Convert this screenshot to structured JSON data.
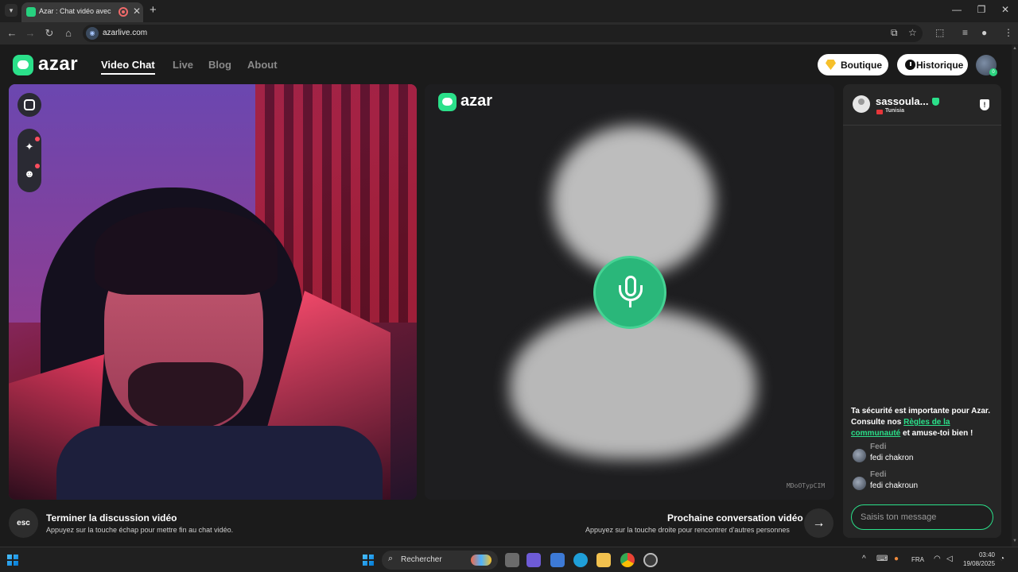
{
  "browser": {
    "tab_title": "Azar : Chat vidéo avec de n",
    "url": "azarlive.com",
    "new_tab_icon": "+",
    "close_icon": "✕"
  },
  "header": {
    "logo_text": "azar",
    "nav": [
      {
        "label": "Video Chat",
        "active": true
      },
      {
        "label": "Live",
        "active": false
      },
      {
        "label": "Blog",
        "active": false
      },
      {
        "label": "About",
        "active": false
      }
    ],
    "shop_label": "Boutique",
    "history_label": "Historique",
    "avatar_badge": "0"
  },
  "partner_video": {
    "logo_text": "azar",
    "video_id": "MDoOTypCIM"
  },
  "controls": {
    "esc_label": "esc",
    "end_title": "Terminer la discussion vidéo",
    "end_desc": "Appuyez sur la touche échap pour mettre fin au chat vidéo.",
    "next_title": "Prochaine conversation vidéo",
    "next_desc": "Appuyez sur la touche droite pour rencontrer d'autres personnes",
    "next_icon": "→"
  },
  "chat": {
    "peer_name": "sassoula...",
    "peer_country": "Tunisia",
    "report_icon": "!",
    "safety_part1": "Ta sécurité est importante pour Azar. Consulte nos ",
    "safety_link": "Règles de la communauté",
    "safety_part2": " et amuse-toi bien !",
    "messages": [
      {
        "name": "Fedi",
        "text": "fedi chakron"
      },
      {
        "name": "Fedi",
        "text": "fedi chakroun"
      }
    ],
    "input_placeholder": "Saisis ton message"
  },
  "taskbar": {
    "search_label": "Rechercher",
    "lang": "FRA",
    "time": "03:40",
    "date": "19/08/2025"
  }
}
